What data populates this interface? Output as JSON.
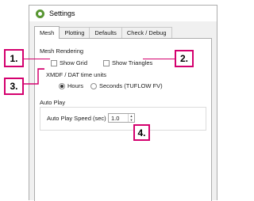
{
  "window": {
    "title": "Settings"
  },
  "tabs": [
    {
      "label": "Mesh",
      "active": true
    },
    {
      "label": "Plotting",
      "active": false
    },
    {
      "label": "Defaults",
      "active": false
    },
    {
      "label": "Check / Debug",
      "active": false
    }
  ],
  "mesh_rendering": {
    "title": "Mesh Rendering",
    "show_grid": {
      "label": "Show Grid",
      "checked": false
    },
    "show_triangles": {
      "label": "Show Triangles",
      "checked": false
    }
  },
  "time_units": {
    "title": "XMDF / DAT time units",
    "hours": {
      "label": "Hours",
      "selected": true
    },
    "seconds": {
      "label": "Seconds (TUFLOW FV)",
      "selected": false
    }
  },
  "auto_play": {
    "title": "Auto Play",
    "speed_label": "Auto Play Speed (sec)",
    "speed_value": "1.0"
  },
  "callouts": [
    "1.",
    "2.",
    "3.",
    "4."
  ],
  "colors": {
    "callout": "#d4006e",
    "qgis_green": "#589632"
  }
}
